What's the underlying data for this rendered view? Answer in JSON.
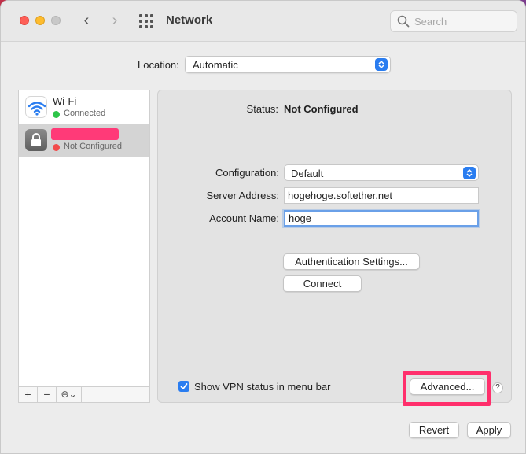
{
  "window": {
    "title": "Network"
  },
  "search": {
    "placeholder": "Search"
  },
  "location": {
    "label": "Location:",
    "value": "Automatic"
  },
  "services": [
    {
      "name": "Wi-Fi",
      "status": "Connected",
      "status_color": "#2ec549",
      "icon": "wifi-icon"
    },
    {
      "name": "",
      "status": "Not Configured",
      "status_color": "#f24b4b",
      "icon": "lock-icon"
    }
  ],
  "list_bar": {
    "add": "+",
    "remove": "−",
    "action": "⊖⌄"
  },
  "detail": {
    "status_label": "Status:",
    "status_value": "Not Configured",
    "configuration_label": "Configuration:",
    "configuration_value": "Default",
    "server_label": "Server Address:",
    "server_value": "hogehoge.softether.net",
    "account_label": "Account Name:",
    "account_value": "hoge",
    "auth_button": "Authentication Settings...",
    "connect_button": "Connect",
    "show_vpn_label": "Show VPN status in menu bar",
    "show_vpn_checked": true,
    "advanced_button": "Advanced...",
    "help": "?"
  },
  "footer": {
    "revert": "Revert",
    "apply": "Apply"
  },
  "colors": {
    "accent": "#2a7df0",
    "highlight": "#ff2f6c",
    "redaction": "#ff3a78"
  }
}
